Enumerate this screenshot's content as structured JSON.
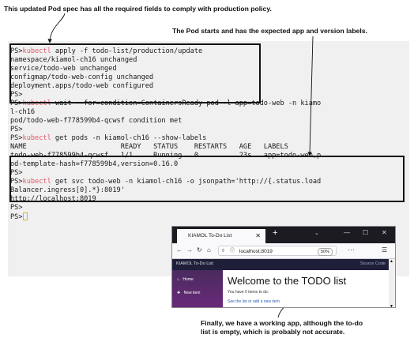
{
  "annotations": {
    "top": "This updated Pod spec has all the required fields to comply with production policy.",
    "middle": "The Pod starts and has the expected app and version labels.",
    "bottom_line1": "Finally, we have a working app, although the to-do",
    "bottom_line2": "list is empty, which is probably not accurate."
  },
  "terminal": {
    "prompt": "PS>",
    "lines": [
      {
        "cmd": "kubectl",
        "rest": " apply -f todo-list/production/update"
      },
      {
        "text": "namespace/kiamol-ch16 unchanged"
      },
      {
        "text": "service/todo-web unchanged"
      },
      {
        "text": "configmap/todo-web-config unchanged"
      },
      {
        "text": "deployment.apps/todo-web configured"
      },
      {
        "prompt_only": true
      },
      {
        "cmd": "kubectl",
        "rest": " wait --for=condition=ContainersReady pod -l app=todo-web -n kiamo"
      },
      {
        "text": "l-ch16"
      },
      {
        "text": "pod/todo-web-f778599b4-qcwsf condition met"
      },
      {
        "prompt_only": true
      },
      {
        "cmd": "kubectl",
        "rest": " get pods -n kiamol-ch16 --show-labels"
      },
      {
        "text": "NAME                       READY   STATUS    RESTARTS   AGE   LABELS"
      },
      {
        "text": "todo-web-f778599b4-qcwsf   1/1     Running   0          23s   app=todo-web,p"
      },
      {
        "text": "od-template-hash=f778599b4,version=0.16.0"
      },
      {
        "prompt_only": true
      },
      {
        "cmd": "kubectl",
        "rest": " get svc todo-web -n kiamol-ch16 -o jsonpath='http://{.status.load"
      },
      {
        "text": "Balancer.ingress[0].*}:8019'"
      },
      {
        "text": "http://localhost:8019"
      },
      {
        "prompt_only": true
      },
      {
        "prompt_only": true,
        "cursor": true
      }
    ]
  },
  "browser": {
    "tab_title": "KIAMOL To-Do List",
    "url": "localhost:8019",
    "zoom": "50%",
    "app_brand": "KIAMOL To-Do List",
    "source_link": "Source Code",
    "sidebar_home": "Home",
    "sidebar_new": "New item",
    "heading": "Welcome to the TODO list",
    "subtext": "You have 0 items to do.",
    "link_text": "See the list or add a new item."
  }
}
